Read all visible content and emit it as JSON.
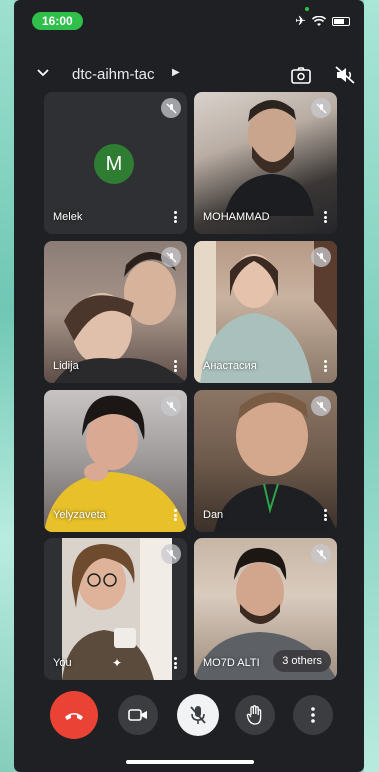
{
  "status_bar": {
    "time": "16:00"
  },
  "header": {
    "room_name": "dtc-aihm-tac"
  },
  "participants": [
    {
      "name": "Melek",
      "avatar_letter": "M",
      "avatar_color": "#2e7d32"
    },
    {
      "name": "MOHAMMAD"
    },
    {
      "name": "Lidija"
    },
    {
      "name": "Анастасия"
    },
    {
      "name": "Yelyzaveta"
    },
    {
      "name": "Dan"
    },
    {
      "name": "You"
    },
    {
      "name": "MO7D ALTI"
    }
  ],
  "others_count_label": "3 others",
  "controls": {
    "end_call_color": "#ea4335",
    "icons": [
      "end-call-icon",
      "camera-icon",
      "mic-off-icon",
      "raise-hand-icon",
      "more-icon"
    ]
  }
}
